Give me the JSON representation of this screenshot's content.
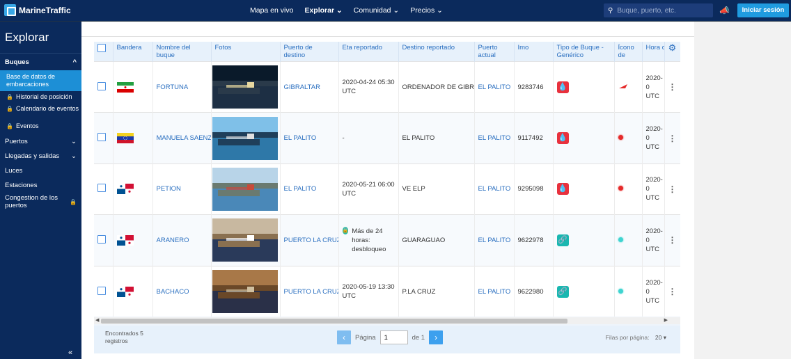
{
  "topbar": {
    "brand": "MarineTraffic",
    "nav": [
      {
        "label": "Mapa en vivo",
        "active": false
      },
      {
        "label": "Explorar",
        "active": true,
        "dropdown": true
      },
      {
        "label": "Comunidad",
        "active": false,
        "dropdown": true
      },
      {
        "label": "Precios",
        "active": false,
        "dropdown": true
      }
    ],
    "search_placeholder": "Buque, puerto, etc.",
    "login_label": "Iniciar sesión"
  },
  "sidebar": {
    "title": "Explorar",
    "sections": [
      {
        "label": "Buques",
        "expanded": true,
        "items": [
          {
            "label": "Base de datos de embarcaciones",
            "active": true,
            "locked": false
          },
          {
            "label": "Historial de posición",
            "active": false,
            "locked": true
          },
          {
            "label": "Calendario de eventos",
            "active": false,
            "locked": true
          },
          {
            "label": "Eventos",
            "active": false,
            "locked": true
          }
        ]
      },
      {
        "label": "Puertos",
        "expandable": true
      },
      {
        "label": "Llegadas y salidas",
        "expandable": true
      },
      {
        "label": "Luces"
      },
      {
        "label": "Estaciones"
      },
      {
        "label": "Congestion de los puertos",
        "locked": true
      }
    ],
    "collapse_icon": "«"
  },
  "table": {
    "headers": [
      "Bandera",
      "Nombre del buque",
      "Fotos",
      "Puerto de destino",
      "Eta reportado",
      "Destino reportado",
      "Puerto actual",
      "Imo",
      "Tipo de Buque - Genérico",
      "Ícono de",
      "Hora de posición"
    ],
    "rows": [
      {
        "flag": "iran",
        "name": "FORTUNA",
        "photo": "night-port",
        "dest_port": "GIBRALTAR",
        "eta": "2020-04-24 05:30 UTC",
        "eta_locked": false,
        "reported_dest": "ORDENADOR DE GIBRAL",
        "current_port": "EL PALITO",
        "imo": "9283746",
        "type_icon": "tanker-icon",
        "type_color": "#e8313d",
        "map_icon": "red-ship-icon",
        "map_color": "#e52a2a",
        "time": "2020-0 UTC"
      },
      {
        "flag": "venezuela",
        "name": "MANUELA SAENZ",
        "photo": "tanker-at-sea",
        "dest_port": "EL PALITO",
        "eta": "-",
        "eta_locked": false,
        "reported_dest": "EL PALITO",
        "current_port": "EL PALITO",
        "imo": "9117492",
        "type_icon": "tanker-icon",
        "type_color": "#e8313d",
        "map_icon": "red-dot-icon",
        "map_color": "#e52a2a",
        "time": "2020-0 UTC"
      },
      {
        "flag": "panama",
        "name": "PETION",
        "photo": "port-dock",
        "dest_port": "EL PALITO",
        "eta": "2020-05-21 06:00 UTC",
        "eta_locked": false,
        "reported_dest": "VE ELP",
        "current_port": "EL PALITO",
        "imo": "9295098",
        "type_icon": "tanker-icon",
        "type_color": "#e8313d",
        "map_icon": "red-dot-icon",
        "map_color": "#e52a2a",
        "time": "2020-0 UTC"
      },
      {
        "flag": "panama",
        "name": "ARANERO",
        "photo": "tug-harbor",
        "dest_port": "PUERTO LA CRUZ",
        "eta": "Más de 24 horas: desbloqueo",
        "eta_locked": true,
        "reported_dest": "GUARAGUAO",
        "current_port": "EL PALITO",
        "imo": "9622978",
        "type_icon": "tug-icon",
        "type_color": "#19b7b0",
        "map_icon": "cyan-dot-icon",
        "map_color": "#3fd4d0",
        "time": "2020-0 UTC"
      },
      {
        "flag": "panama",
        "name": "BACHACO",
        "photo": "tug-old-town",
        "dest_port": "PUERTO LA CRUZ",
        "eta": "2020-05-19 13:30 UTC",
        "eta_locked": false,
        "reported_dest": "P.LA CRUZ",
        "current_port": "EL PALITO",
        "imo": "9622980",
        "type_icon": "tug-icon",
        "type_color": "#19b7b0",
        "map_icon": "cyan-dot-icon",
        "map_color": "#3fd4d0",
        "time": "2020-0 UTC"
      }
    ]
  },
  "footer": {
    "found_label": "Encontrados",
    "found_count": "5",
    "found_suffix": "registros",
    "page_label": "Página",
    "page_value": "1",
    "page_of": "de 1",
    "rows_label": "Filas por página:",
    "rows_value": "20"
  }
}
